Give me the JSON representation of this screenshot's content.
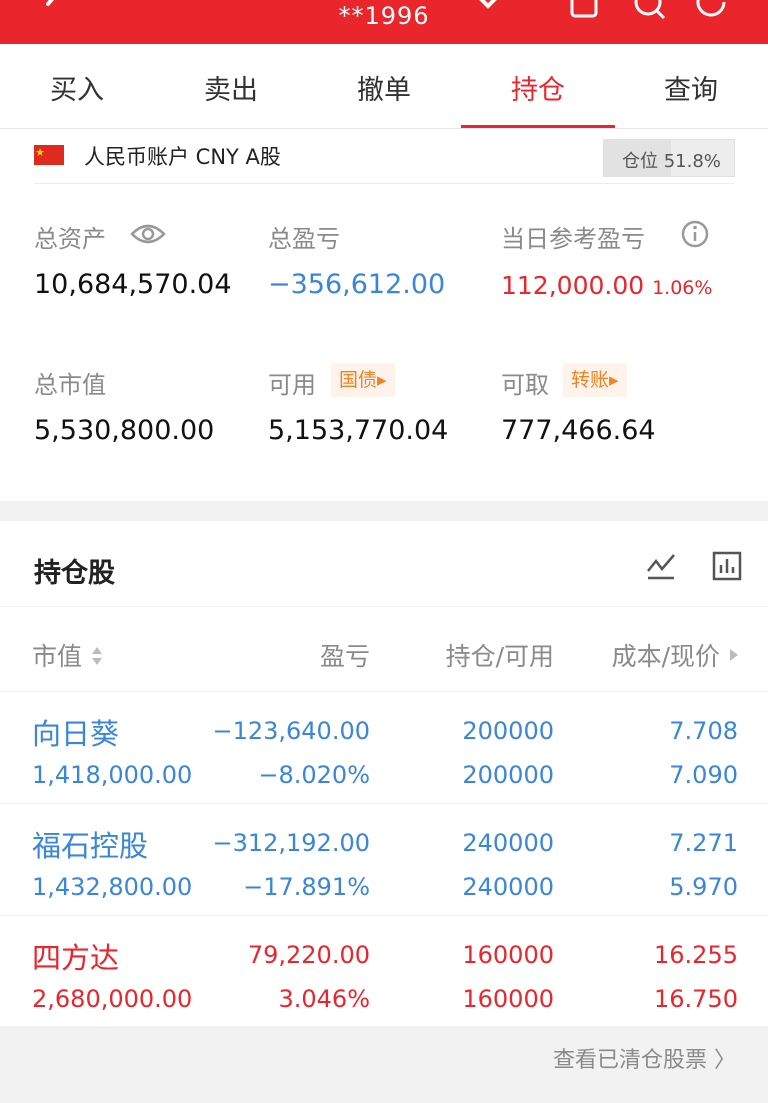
{
  "header": {
    "title": "**1996"
  },
  "tabs": [
    {
      "label": "买入"
    },
    {
      "label": "卖出"
    },
    {
      "label": "撤单"
    },
    {
      "label": "持仓"
    },
    {
      "label": "查询"
    }
  ],
  "account": {
    "name": "人民币账户 CNY A股",
    "position_ratio_label": "仓位 51.8%",
    "position_ratio": 0.518,
    "total_assets": {
      "label": "总资产",
      "value": "10,684,570.04"
    },
    "total_pnl": {
      "label": "总盈亏",
      "value": "−356,612.00"
    },
    "daily_pnl": {
      "label": "当日参考盈亏",
      "value": "112,000.00",
      "pct": "1.06%"
    },
    "market_value": {
      "label": "总市值",
      "value": "5,530,800.00"
    },
    "available": {
      "label": "可用",
      "value": "5,153,770.04",
      "chip": "国债▸"
    },
    "withdrawable": {
      "label": "可取",
      "value": "777,466.64",
      "chip": "转账▸"
    }
  },
  "holdings": {
    "title": "持仓股",
    "columns": {
      "value": "市值",
      "pnl": "盈亏",
      "qty": "持仓/可用",
      "price": "成本/现价"
    },
    "rows": [
      {
        "name": "向日葵",
        "market_value": "1,418,000.00",
        "pnl": "−123,640.00",
        "pnl_pct": "−8.020%",
        "holding": "200000",
        "available": "200000",
        "cost": "7.708",
        "price": "7.090",
        "trend": "down"
      },
      {
        "name": "福石控股",
        "market_value": "1,432,800.00",
        "pnl": "−312,192.00",
        "pnl_pct": "−17.891%",
        "holding": "240000",
        "available": "240000",
        "cost": "7.271",
        "price": "5.970",
        "trend": "down"
      },
      {
        "name": "四方达",
        "market_value": "2,680,000.00",
        "pnl": "79,220.00",
        "pnl_pct": "3.046%",
        "holding": "160000",
        "available": "160000",
        "cost": "16.255",
        "price": "16.750",
        "trend": "up"
      }
    ],
    "cleared_link": "查看已清仓股票 〉"
  },
  "colors": {
    "header_red": "#e8262c",
    "loss_blue": "#3a86d8",
    "gain_red": "#e8262c",
    "chip_orange": "#f08324"
  }
}
